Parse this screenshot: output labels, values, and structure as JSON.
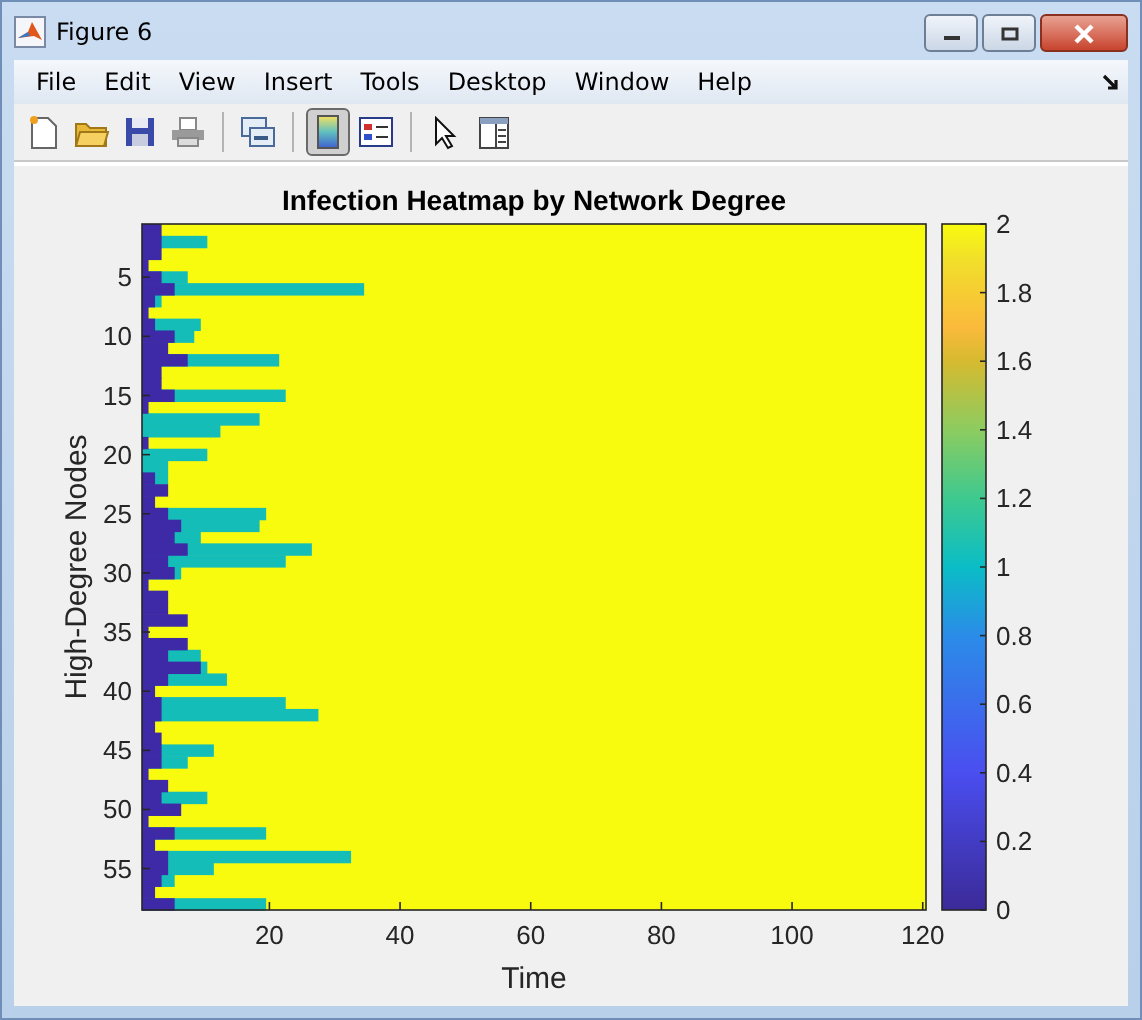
{
  "window": {
    "title": "Figure 6"
  },
  "menu": [
    {
      "label": "File"
    },
    {
      "label": "Edit"
    },
    {
      "label": "View"
    },
    {
      "label": "Insert"
    },
    {
      "label": "Tools"
    },
    {
      "label": "Desktop"
    },
    {
      "label": "Window"
    },
    {
      "label": "Help"
    }
  ],
  "toolbar": [
    {
      "buttons": [
        {
          "kind": "new",
          "pressed": false
        },
        {
          "kind": "open",
          "pressed": false
        },
        {
          "kind": "save",
          "pressed": false
        },
        {
          "kind": "print",
          "pressed": false
        }
      ]
    },
    {
      "buttons": [
        {
          "kind": "link",
          "pressed": false
        }
      ]
    },
    {
      "buttons": [
        {
          "kind": "colorbar",
          "pressed": true
        },
        {
          "kind": "legend",
          "pressed": false
        }
      ]
    },
    {
      "buttons": [
        {
          "kind": "pointer",
          "pressed": false
        },
        {
          "kind": "panel",
          "pressed": false
        }
      ]
    }
  ],
  "plot": {
    "title": "Infection Heatmap by Network Degree",
    "xlabel": "Time",
    "ylabel": "High-Degree Nodes",
    "xticks": [
      "20",
      "40",
      "60",
      "80",
      "100",
      "120"
    ],
    "yticks": [
      "5",
      "10",
      "15",
      "20",
      "25",
      "30",
      "35",
      "40",
      "45",
      "50",
      "55"
    ],
    "colorbar_ticks": [
      "2",
      "1.8",
      "1.6",
      "1.4",
      "1.2",
      "1",
      "0.8",
      "0.6",
      "0.4",
      "0.2",
      "0"
    ]
  }
}
